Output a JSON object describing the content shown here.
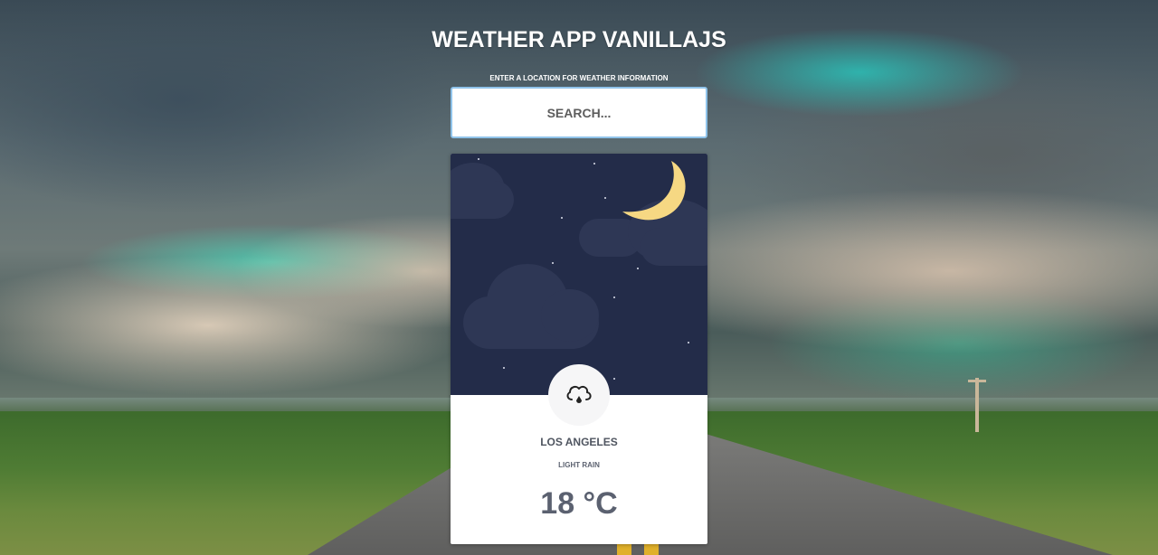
{
  "app": {
    "title": "WEATHER APP VANILLAJS",
    "search_label": "ENTER A LOCATION FOR WEATHER INFORMATION",
    "search_placeholder": "SEARCH...",
    "search_value": ""
  },
  "weather": {
    "city": "LOS ANGELES",
    "condition": "LIGHT RAIN",
    "temperature": "18 °C",
    "icon": "cloud-rain-icon",
    "scene": "night-sky-moon-clouds"
  },
  "colors": {
    "card_sky": "#232c49",
    "cloud": "#2e3755",
    "moon": "#f6d883",
    "accent_border": "#8fc3ea",
    "text": "#4f5560"
  }
}
